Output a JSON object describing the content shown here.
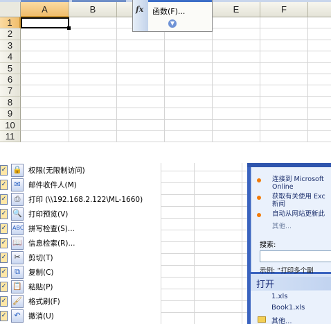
{
  "spreadsheet": {
    "columns": [
      "A",
      "B",
      "C",
      "D",
      "E",
      "F"
    ],
    "rows": [
      "1",
      "2",
      "3",
      "4",
      "5",
      "6",
      "7",
      "8",
      "9",
      "10",
      "11"
    ],
    "selected_column": "A",
    "selected_row": "1"
  },
  "insert_menu": {
    "fx_icon": "fx",
    "function_label": "函数(F)...",
    "expand_icon": "chevron-down-icon"
  },
  "customize_list": {
    "items": [
      {
        "label": "权限(无限制访问)",
        "icon": "permission-icon",
        "checked": true
      },
      {
        "label": "邮件收件人(M)",
        "icon": "mail-recipient-icon",
        "checked": true
      },
      {
        "label": "打印 (\\\\192.168.2.122\\ML-1660)",
        "icon": "printer-icon",
        "checked": true
      },
      {
        "label": "打印预览(V)",
        "icon": "print-preview-icon",
        "checked": true
      },
      {
        "label": "拼写检查(S)...",
        "icon": "spell-check-icon",
        "checked": true
      },
      {
        "label": "信息检索(R)...",
        "icon": "research-icon",
        "checked": true
      },
      {
        "label": "剪切(T)",
        "icon": "scissors-icon",
        "checked": true
      },
      {
        "label": "复制(C)",
        "icon": "copy-icon",
        "checked": true
      },
      {
        "label": "粘贴(P)",
        "icon": "paste-icon",
        "checked": true
      },
      {
        "label": "格式刷(F)",
        "icon": "format-painter-icon",
        "checked": true
      },
      {
        "label": "撤消(U)",
        "icon": "undo-icon",
        "checked": true
      }
    ]
  },
  "task_pane": {
    "links": [
      {
        "line1": "连接到 Microsoft",
        "line2": "Online"
      },
      {
        "line1": "获取有关使用 Exc",
        "line2": "新闻"
      },
      {
        "line1": "自动从网站更新此",
        "line2": ""
      }
    ],
    "more_link": "其他...",
    "search_label": "搜索:",
    "example_text": "示例: “打印多个副",
    "open_title": "打开",
    "recent_files": [
      "1.xls",
      "Book1.xls"
    ],
    "open_more": "其他..."
  },
  "colors": {
    "selected_header": "#f0bd6b",
    "task_pane_blue": "#3a63bf",
    "bullet_orange": "#f27b0a"
  }
}
